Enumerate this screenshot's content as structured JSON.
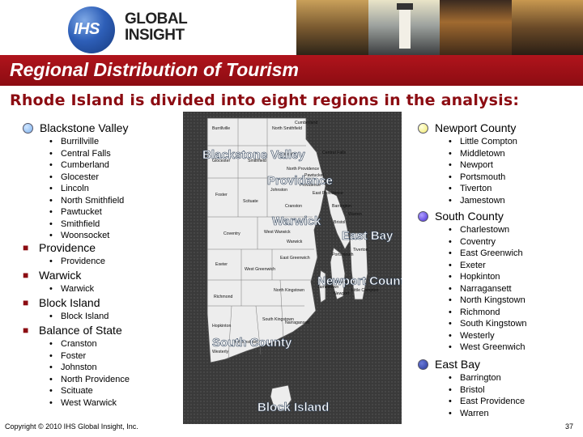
{
  "header": {
    "logo_mark": "IHS",
    "logo_line1": "GLOBAL",
    "logo_line2": "INSIGHT"
  },
  "title": "Regional Distribution of Tourism",
  "subtitle": "Rhode Island is divided into eight regions in the analysis:",
  "left_regions": [
    {
      "name": "Blackstone Valley",
      "marker": "circle",
      "color": "#a8cdf5",
      "towns": [
        "Burrillville",
        "Central Falls",
        "Cumberland",
        "Glocester",
        "Lincoln",
        "North Smithfield",
        "Pawtucket",
        "Smithfield",
        "Woonsocket"
      ]
    },
    {
      "name": "Providence",
      "marker": "square",
      "towns": [
        "Providence"
      ]
    },
    {
      "name": "Warwick",
      "marker": "square",
      "towns": [
        "Warwick"
      ]
    },
    {
      "name": "Block Island",
      "marker": "square",
      "towns": [
        "Block Island"
      ]
    },
    {
      "name": "Balance of State",
      "marker": "square",
      "towns": [
        "Cranston",
        "Foster",
        "Johnston",
        "North Providence",
        "Scituate",
        "West Warwick"
      ]
    }
  ],
  "right_regions": [
    {
      "name": "Newport County",
      "color": "#f5ef8a",
      "towns": [
        "Little Compton",
        "Middletown",
        "Newport",
        "Portsmouth",
        "Tiverton",
        "Jamestown"
      ]
    },
    {
      "name": "South County",
      "color": "#5a3fe0",
      "towns": [
        "Charlestown",
        "Coventry",
        "East Greenwich",
        "Exeter",
        "Hopkinton",
        "Narragansett",
        "North Kingstown",
        "Richmond",
        "South Kingstown",
        "Westerly",
        "West Greenwich"
      ]
    },
    {
      "name": "East Bay",
      "color": "#3a4ab0",
      "towns": [
        "Barrington",
        "Bristol",
        "East Providence",
        "Warren"
      ]
    }
  ],
  "map": {
    "labels": [
      "Blackstone Valley",
      "Providence",
      "Warwick",
      "East Bay",
      "Newport County",
      "South County",
      "Block Island"
    ],
    "towns": [
      "Burrillville",
      "North Smithfield",
      "Cumberland",
      "Lincoln",
      "Glocester",
      "Smithfield",
      "Central Falls",
      "Foster",
      "Scituate",
      "Johnston",
      "North Providence",
      "Pawtucket",
      "East Providence",
      "Coventry",
      "West Warwick",
      "East Greenwich",
      "Barrington",
      "Bristol",
      "Warren",
      "Exeter",
      "North Kingstown",
      "Portsmouth",
      "Middletown",
      "Newport",
      "Tiverton",
      "Little Compton",
      "Jamestown",
      "Richmond",
      "Hopkinton",
      "South Kingstown",
      "Charlestown",
      "Westerly",
      "Narragansett",
      "West Greenwich",
      "Cranston",
      "Warwick",
      "Providence"
    ]
  },
  "footer": "Copyright © 2010 IHS Global Insight, Inc.",
  "page_number": "37"
}
